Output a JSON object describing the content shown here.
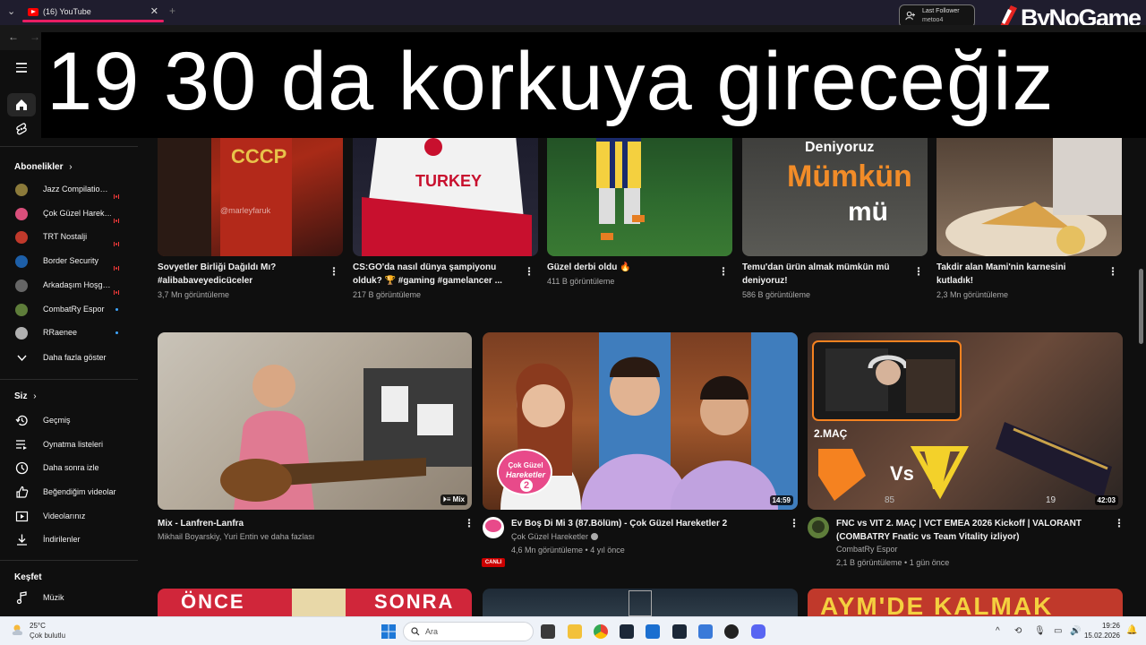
{
  "browser": {
    "tab_title": "(16) YouTube",
    "tab_close": "✕",
    "tab_new": "+",
    "tab_chevron": "⌄",
    "back": "←",
    "forward": "→"
  },
  "follower_widget": {
    "line1": "Last Follower",
    "line2": "metoo4"
  },
  "brand": {
    "text": "ByNoGame"
  },
  "overlay": {
    "caption": "19 30 da korkuya gireceğiz"
  },
  "sidebar": {
    "subscriptions_title": "Abonelikler",
    "subscriptions": [
      {
        "name": "Jazz Compilatio…",
        "status": "live",
        "avatar_color": "#8b7a3a"
      },
      {
        "name": "Çok Güzel Harek…",
        "status": "live",
        "avatar_color": "#d94f7b"
      },
      {
        "name": "TRT Nostalji",
        "status": "live",
        "avatar_color": "#c0392b"
      },
      {
        "name": "Border Security",
        "status": "live",
        "avatar_color": "#1d5fa8"
      },
      {
        "name": "Arkadaşım Hoşg…",
        "status": "live",
        "avatar_color": "#666666"
      },
      {
        "name": "CombatRy Espor",
        "status": "new",
        "avatar_color": "#5e7d3a"
      },
      {
        "name": "RRaenee",
        "status": "new",
        "avatar_color": "#b0b0b0"
      }
    ],
    "show_more": "Daha fazla göster",
    "you_title": "Siz",
    "you_items": [
      {
        "label": "Geçmiş",
        "icon": "history-icon"
      },
      {
        "label": "Oynatma listeleri",
        "icon": "playlists-icon"
      },
      {
        "label": "Daha sonra izle",
        "icon": "watch-later-icon"
      },
      {
        "label": "Beğendiğim videolar",
        "icon": "thumbs-up-icon"
      },
      {
        "label": "Videolarınız",
        "icon": "your-videos-icon"
      },
      {
        "label": "İndirilenler",
        "icon": "download-icon"
      }
    ],
    "explore_title": "Keşfet",
    "explore_items": [
      {
        "label": "Müzik",
        "icon": "music-icon"
      }
    ]
  },
  "shorts_row": [
    {
      "title_line1": "Sovyetler Birliği Dağıldı Mı?",
      "title_line2": "#alibabaveyedicüceler",
      "views": "3,7 Mn görüntüleme",
      "watermark": "@marleyfaruk"
    },
    {
      "title_line1": "CS:GO'da nasıl dünya şampiyonu",
      "title_line2": "olduk? 🏆 #gaming #gamelancer ...",
      "views": "217 B görüntüleme",
      "thumb_text": "TURKEY"
    },
    {
      "title_line1": "Güzel derbi oldu 🔥",
      "title_line2": "",
      "views": "411 B görüntüleme"
    },
    {
      "title_line1": "Temu'dan ürün almak mümkün mü",
      "title_line2": "deniyoruz!",
      "views": "586 B görüntüleme",
      "thumb_text1": "Deniyoruz",
      "thumb_text2": "Mümkün",
      "thumb_text3": "mü"
    },
    {
      "title_line1": "Takdir alan Mami'nin karnesini",
      "title_line2": "kutladık!",
      "views": "2,3 Mn görüntüleme"
    }
  ],
  "videos": [
    {
      "title_line1": "Mix - Lanfren-Lanfra",
      "title_line2": "",
      "channel": "Mikhail Boyarskiy, Yuri Entin ve daha fazlası",
      "meta": "",
      "badge": "Mix",
      "badge_icon": "mix-icon"
    },
    {
      "title_line1": "Ev Boş Di Mi 3 (87.Bölüm) - Çok Güzel Hareketler 2",
      "title_line2": "",
      "channel": "Çok Güzel Hareketler",
      "meta": "4,6 Mn görüntüleme • 4 yıl önce",
      "badge": "14:59",
      "live_label": "CANLI",
      "thumb_logo_top": "Çok Güzel",
      "thumb_logo_mid": "Hareketler",
      "thumb_logo_num": "2"
    },
    {
      "title_line1": "FNC vs VIT 2. MAÇ | VCT EMEA 2026 Kickoff | VALORANT",
      "title_line2": "(COMBATRY Fnatic vs Team Vitality izliyor)",
      "channel": "CombatRy Espor",
      "meta": "2,1 B görüntüleme • 1 gün önce",
      "badge": "42:03",
      "thumb_label": "2.MAÇ",
      "thumb_vs": "Vs",
      "thumb_num1": "85",
      "thumb_num2": "19"
    }
  ],
  "bottom_row": [
    {
      "thumb_left": "ÖNCE",
      "thumb_right": "SONRA"
    },
    {
      "thumb_text": ""
    },
    {
      "thumb_text": "AYM'DE KALMAK"
    }
  ],
  "taskbar": {
    "weather_temp": "25°C",
    "weather_desc": "Çok bulutlu",
    "search_placeholder": "Ara",
    "time": "19:26",
    "date": "15.02.2026"
  },
  "colors": {
    "accent": "#ff0000",
    "tab_underline": "#e91e63",
    "background": "#0f0f0f"
  }
}
